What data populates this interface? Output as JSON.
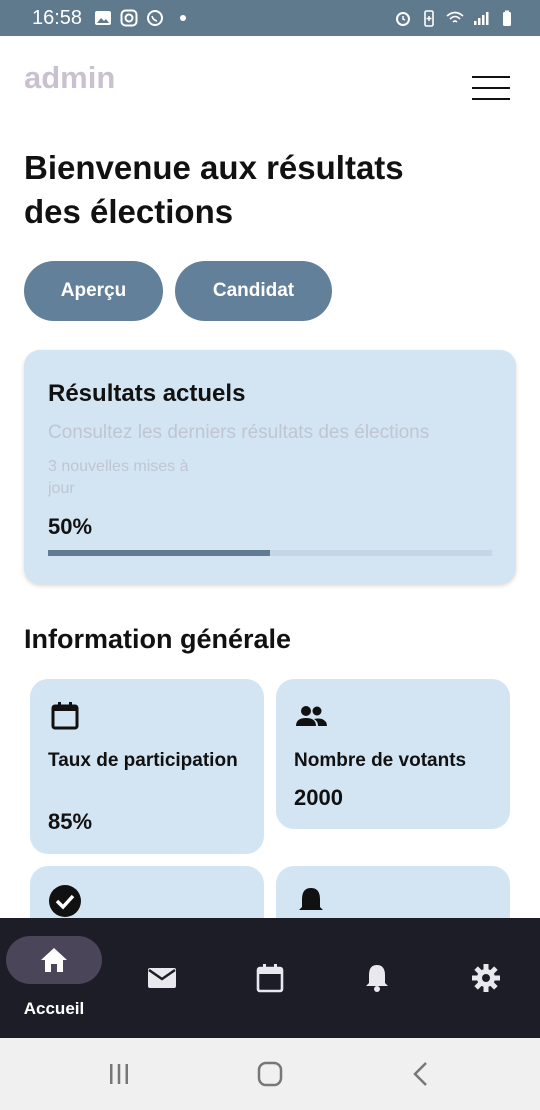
{
  "status_bar": {
    "time": "16:58",
    "left_icons": [
      "image-icon",
      "instagram-icon",
      "whatsapp-icon",
      "dot-icon"
    ],
    "right_icons": [
      "alarm-icon",
      "battery-saver-icon",
      "wifi-icon",
      "signal-icon",
      "battery-icon"
    ]
  },
  "header": {
    "brand": "admin",
    "menu_icon": "hamburger-menu-icon"
  },
  "page": {
    "title": "Bienvenue aux résultats des élections"
  },
  "tabs": [
    {
      "label": "Aperçu"
    },
    {
      "label": "Candidat"
    }
  ],
  "results_card": {
    "title": "Résultats actuels",
    "subtitle": "Consultez les derniers résultats des élections",
    "updates": "3 nouvelles mises à jour",
    "percent_label": "50%",
    "progress": 0.5
  },
  "info_section": {
    "title": "Information générale",
    "cards": [
      {
        "icon": "calendar-icon",
        "label": "Taux de participation",
        "value": "85%"
      },
      {
        "icon": "people-icon",
        "label": "Nombre de votants",
        "value": "2000"
      },
      {
        "icon": "check-circle-icon",
        "label": "",
        "value": ""
      },
      {
        "icon": "bell-icon",
        "label": "",
        "value": ""
      }
    ]
  },
  "bottom_nav": {
    "items": [
      {
        "icon": "home-icon",
        "label": "Accueil",
        "active": true
      },
      {
        "icon": "mail-icon",
        "label": ""
      },
      {
        "icon": "calendar-icon",
        "label": ""
      },
      {
        "icon": "bell-icon",
        "label": ""
      },
      {
        "icon": "settings-gear-icon",
        "label": ""
      }
    ]
  },
  "colors": {
    "status_bar": "#5f7a8c",
    "accent": "#63809a",
    "card_bg": "#d3e4f2",
    "nav_bg": "#1d1d27",
    "nav_active": "#4a4558",
    "brand": "#c9c1d0"
  }
}
